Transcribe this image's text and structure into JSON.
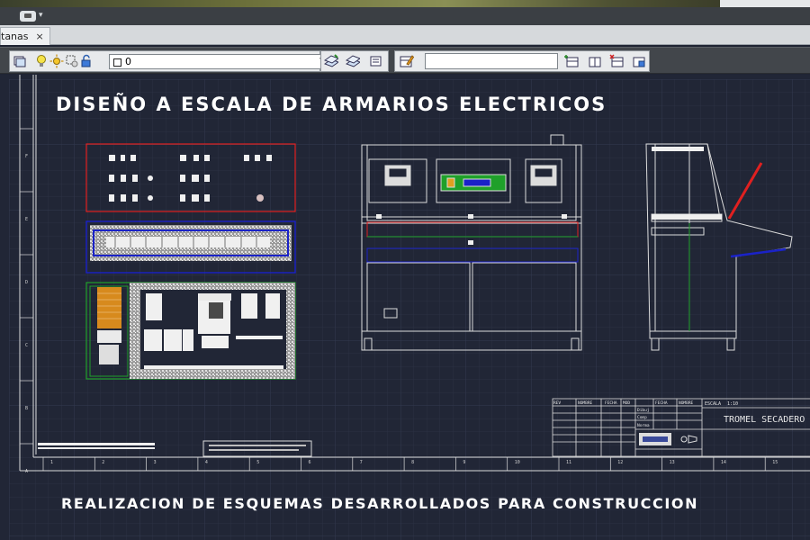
{
  "window": {
    "tab_label": "tanas",
    "tab_close": "×"
  },
  "toolbar": {
    "layer_name": "0"
  },
  "drawing": {
    "title": "DISEÑO A ESCALA DE ARMARIOS ELECTRICOS",
    "subtitle": "REALIZACION DE ESQUEMAS DESARROLLADOS PARA CONSTRUCCION",
    "titleblock": {
      "project": "TROMEL SECADERO",
      "escala_label": "ESCALA",
      "escala_value": "1:10",
      "col_fecha": "FECHA",
      "col_nombre": "NOMBRE",
      "row_dib": "Dibuj",
      "row_comp": "Comp",
      "row_norma": "Norma",
      "rev_label": "REV",
      "rev_nombre": "NOMBRE",
      "rev_fecha": "FECHA",
      "rev_mod": "MOD"
    },
    "ruler_ticks": [
      "1",
      "2",
      "3",
      "4",
      "5",
      "6",
      "7",
      "8",
      "9",
      "10",
      "11",
      "12",
      "13",
      "14",
      "15"
    ],
    "left_ticks": [
      "F",
      "E",
      "D",
      "C",
      "B",
      "A"
    ]
  },
  "colors": {
    "canvas_bg": "#212636",
    "red": "#e02020",
    "blue": "#1a22c8",
    "green": "#1fa02a",
    "white_lines": "#dcdcdc"
  }
}
